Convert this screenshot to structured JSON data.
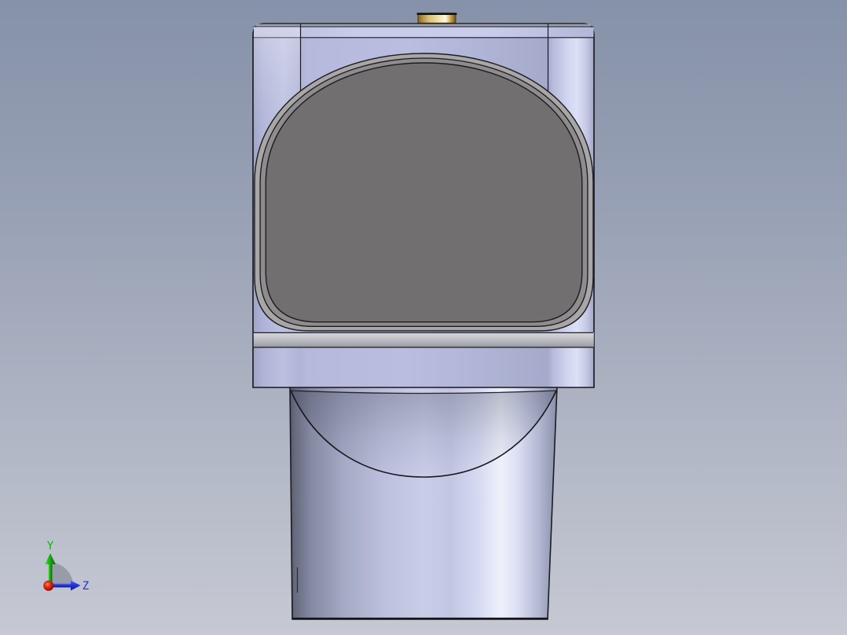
{
  "viewport": {
    "type": "3d-cad-viewport",
    "background_top_color": "#8692a9",
    "background_bottom_color": "#c6c9d3"
  },
  "model": {
    "part_base_color": "#b6b9dc",
    "part_highlight_color": "#dde1f6",
    "top_face_edge_color": "#9ca0ae",
    "bore_outer_ring_color": "#a8a6a7",
    "bore_mid_ring_color": "#8e8c8d",
    "bore_face_color": "#716f70",
    "ledge_band_color": "#c2c2c9",
    "brass_fitting_color": "#ecd898",
    "edge_outline_color": "#17171d"
  },
  "triad": {
    "y_axis": {
      "label": "Y",
      "color": "#00c000"
    },
    "z_axis": {
      "label": "Z",
      "color": "#2331dd"
    },
    "x_axis": {
      "color": "#c41505"
    },
    "fan_color": "rgba(128,133,146,0.62)"
  }
}
